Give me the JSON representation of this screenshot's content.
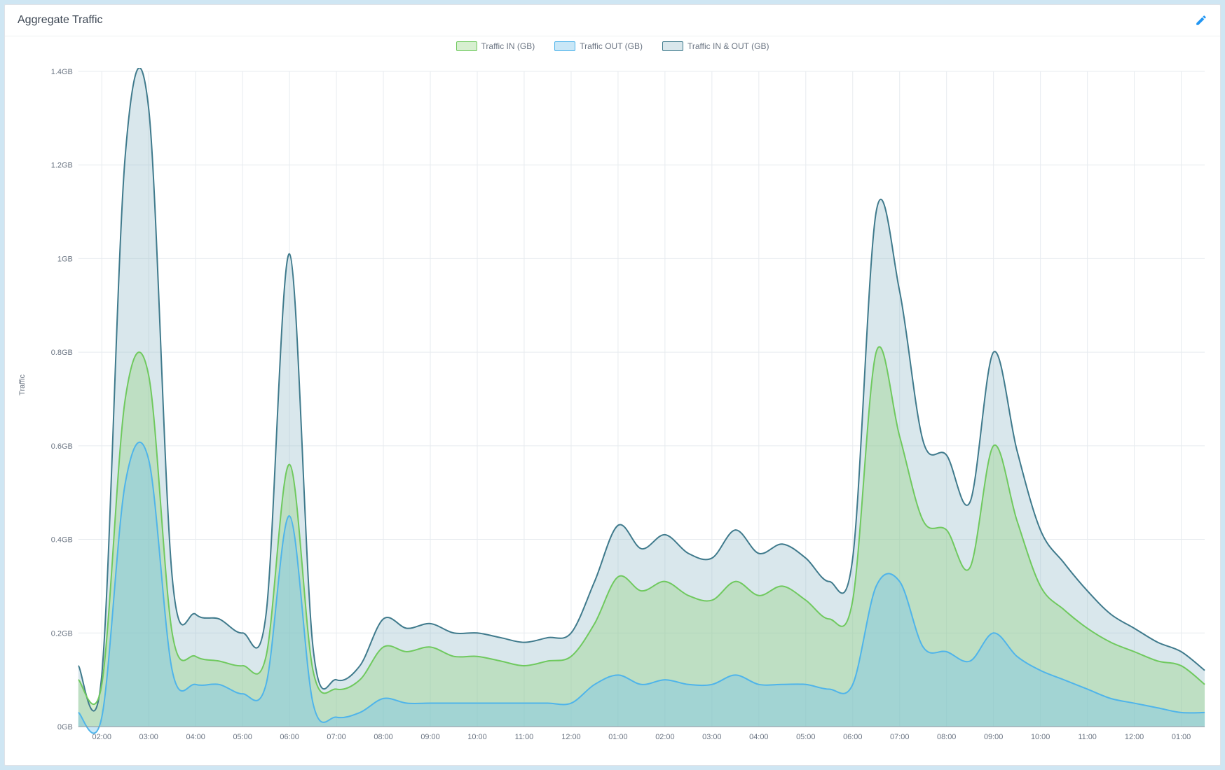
{
  "header": {
    "title": "Aggregate Traffic",
    "edit_icon": "pencil-icon"
  },
  "legend": [
    {
      "label": "Traffic IN (GB)",
      "stroke": "#6fc95e",
      "fill": "rgba(140,210,120,0.35)"
    },
    {
      "label": "Traffic OUT (GB)",
      "stroke": "#4fb4ea",
      "fill": "rgba(120,195,235,0.40)"
    },
    {
      "label": "Traffic IN & OUT (GB)",
      "stroke": "#3f7a8c",
      "fill": "rgba(145,185,200,0.35)"
    }
  ],
  "axes": {
    "ylabel": "Traffic",
    "yticks": [
      "0GB",
      "0.2GB",
      "0.4GB",
      "0.6GB",
      "0.8GB",
      "1GB",
      "1.2GB",
      "1.4GB"
    ],
    "ylim": [
      0,
      1.4
    ],
    "xticks": [
      "02:00",
      "03:00",
      "04:00",
      "05:00",
      "06:00",
      "07:00",
      "08:00",
      "09:00",
      "10:00",
      "11:00",
      "12:00",
      "01:00",
      "02:00",
      "03:00",
      "04:00",
      "05:00",
      "06:00",
      "07:00",
      "08:00",
      "09:00",
      "10:00",
      "11:00",
      "12:00",
      "01:00"
    ]
  },
  "chart_data": {
    "type": "area",
    "title": "Aggregate Traffic",
    "xlabel": "",
    "ylabel": "Traffic",
    "ylim": [
      0,
      1.4
    ],
    "x": [
      "01:30",
      "02:00",
      "02:30",
      "03:00",
      "03:30",
      "04:00",
      "04:30",
      "05:00",
      "05:30",
      "06:00",
      "06:30",
      "07:00",
      "07:30",
      "08:00",
      "08:30",
      "09:00",
      "09:30",
      "10:00",
      "10:30",
      "11:00",
      "11:30",
      "12:00",
      "12:30",
      "01:00",
      "01:30",
      "02:00",
      "02:30",
      "03:00",
      "03:30",
      "04:00",
      "04:30",
      "05:00",
      "05:30",
      "06:00",
      "06:30",
      "07:00",
      "07:30",
      "08:00",
      "08:30",
      "09:00",
      "09:30",
      "10:00",
      "10:30",
      "11:00",
      "11:30",
      "12:00",
      "12:30",
      "01:00",
      "01:30"
    ],
    "series": [
      {
        "name": "Traffic IN (GB)",
        "values": [
          0.1,
          0.09,
          0.7,
          0.75,
          0.2,
          0.15,
          0.14,
          0.13,
          0.15,
          0.56,
          0.12,
          0.08,
          0.1,
          0.17,
          0.16,
          0.17,
          0.15,
          0.15,
          0.14,
          0.13,
          0.14,
          0.15,
          0.22,
          0.32,
          0.29,
          0.31,
          0.28,
          0.27,
          0.31,
          0.28,
          0.3,
          0.27,
          0.23,
          0.27,
          0.8,
          0.62,
          0.44,
          0.42,
          0.34,
          0.6,
          0.44,
          0.3,
          0.25,
          0.21,
          0.18,
          0.16,
          0.14,
          0.13,
          0.09
        ]
      },
      {
        "name": "Traffic OUT (GB)",
        "values": [
          0.03,
          0.02,
          0.52,
          0.57,
          0.12,
          0.09,
          0.09,
          0.07,
          0.09,
          0.45,
          0.05,
          0.02,
          0.03,
          0.06,
          0.05,
          0.05,
          0.05,
          0.05,
          0.05,
          0.05,
          0.05,
          0.05,
          0.09,
          0.11,
          0.09,
          0.1,
          0.09,
          0.09,
          0.11,
          0.09,
          0.09,
          0.09,
          0.08,
          0.09,
          0.3,
          0.31,
          0.17,
          0.16,
          0.14,
          0.2,
          0.15,
          0.12,
          0.1,
          0.08,
          0.06,
          0.05,
          0.04,
          0.03,
          0.03
        ]
      },
      {
        "name": "Traffic IN & OUT (GB)",
        "values": [
          0.13,
          0.11,
          1.22,
          1.32,
          0.32,
          0.24,
          0.23,
          0.2,
          0.24,
          1.01,
          0.17,
          0.1,
          0.13,
          0.23,
          0.21,
          0.22,
          0.2,
          0.2,
          0.19,
          0.18,
          0.19,
          0.2,
          0.31,
          0.43,
          0.38,
          0.41,
          0.37,
          0.36,
          0.42,
          0.37,
          0.39,
          0.36,
          0.31,
          0.36,
          1.1,
          0.93,
          0.61,
          0.58,
          0.48,
          0.8,
          0.59,
          0.42,
          0.35,
          0.29,
          0.24,
          0.21,
          0.18,
          0.16,
          0.12
        ]
      }
    ],
    "colors": {
      "Traffic IN (GB)": "#6fc95e",
      "Traffic OUT (GB)": "#4fb4ea",
      "Traffic IN & OUT (GB)": "#3f7a8c"
    },
    "legend_position": "top"
  }
}
